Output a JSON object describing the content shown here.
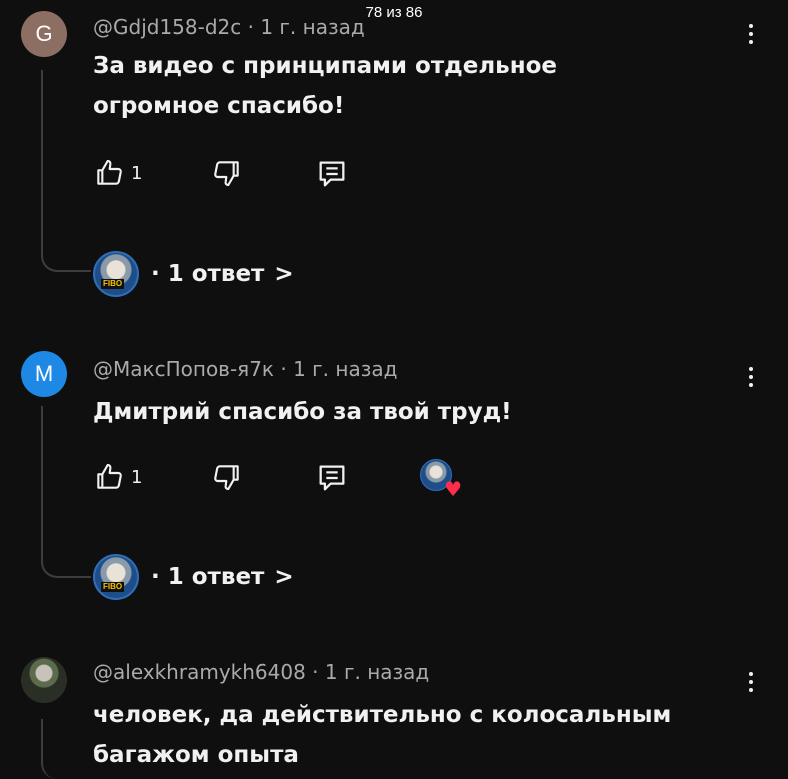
{
  "counter": "78 из 86",
  "colors": {
    "bg": "#0f0f0f",
    "avatar_g": "#8d6e63",
    "avatar_m": "#1e88e5",
    "heart": "#ff2e4c"
  },
  "comments": [
    {
      "avatar_letter": "G",
      "author": "@Gdjd158-d2c",
      "time": "1 г. назад",
      "text": "За видео с принципами отдельное огромное спасибо!",
      "likes": "1",
      "replies_label": "· 1 ответ",
      "replies_chevron": ">",
      "creator_heart": false
    },
    {
      "avatar_letter": "M",
      "author": "@МаксПопов-я7к",
      "time": "1 г. назад",
      "text": "Дмитрий спасибо за твой труд!",
      "likes": "1",
      "replies_label": "· 1 ответ",
      "replies_chevron": ">",
      "creator_heart": true
    },
    {
      "avatar_letter": "",
      "author": "@alexkhramykh6408",
      "time": "1 г. назад",
      "text": "человек, да действительно с колосальным багажом опыта"
    }
  ],
  "icons": [
    "like-icon",
    "dislike-icon",
    "reply-icon",
    "more-vert-icon",
    "heart-icon",
    "chevron-right-icon"
  ],
  "channel_badge": "FIBO"
}
